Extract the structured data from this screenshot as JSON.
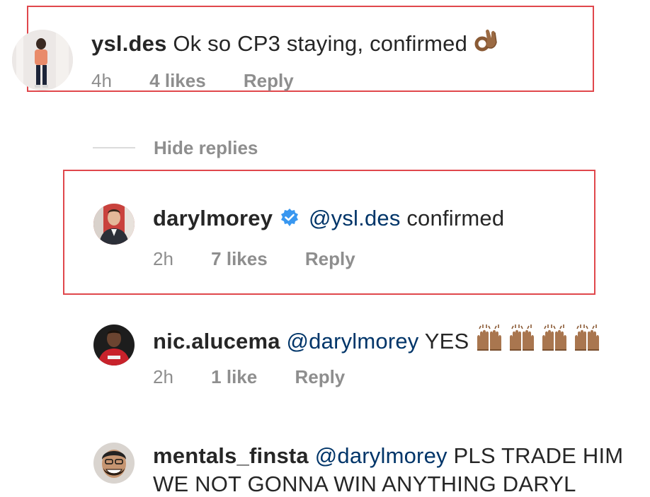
{
  "comments": [
    {
      "username": "ysl.des",
      "text": "Ok so CP3 staying, confirmed",
      "emoji": "ok-hand-emoji",
      "time": "4h",
      "likes": "4 likes",
      "reply": "Reply"
    },
    {
      "username": "darylmorey",
      "verified": true,
      "mention": "@ysl.des",
      "text": "confirmed",
      "time": "2h",
      "likes": "7 likes",
      "reply": "Reply"
    },
    {
      "username": "nic.alucema",
      "mention": "@darylmorey",
      "text": "YES",
      "emoji": "raising-hands-emoji-x4",
      "time": "2h",
      "likes": "1 like",
      "reply": "Reply"
    },
    {
      "username": "mentals_finsta",
      "mention": "@darylmorey",
      "text": "PLS TRADE HIM",
      "text_line2": "WE NOT GONNA WIN ANYTHING DARYL"
    }
  ],
  "hide_replies": "Hide replies",
  "colors": {
    "highlight": "#e0474c",
    "mention": "#003569",
    "meta": "#8e8e8e",
    "verified": "#3897f0"
  }
}
